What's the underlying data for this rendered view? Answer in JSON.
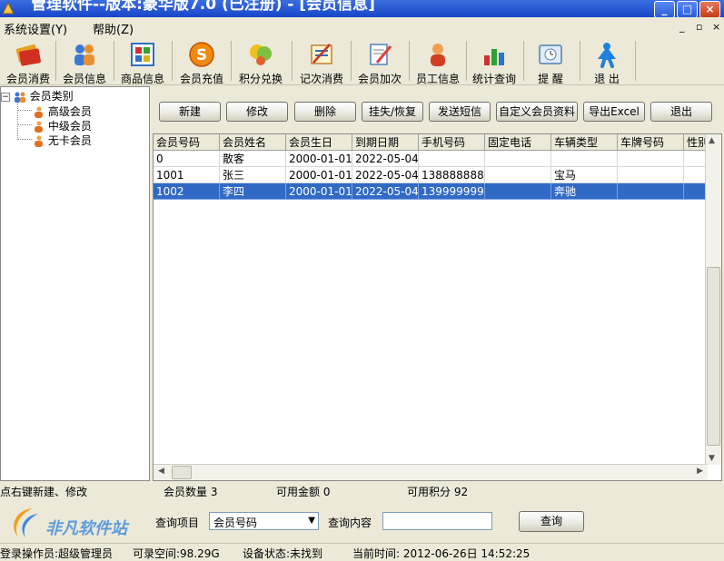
{
  "window": {
    "title": "管理软件--版本:豪华版7.0 (已注册) - [会员信息]",
    "controls": [
      "_",
      "□",
      "×"
    ]
  },
  "menubar": {
    "items": [
      "系统设置(Y)",
      "帮助(Z)"
    ],
    "mdi_controls": [
      "_",
      "▫",
      "×"
    ]
  },
  "toolbar": {
    "items": [
      {
        "label": "会员消费",
        "icon": "member-consume-icon"
      },
      {
        "label": "会员信息",
        "icon": "member-info-icon"
      },
      {
        "label": "商品信息",
        "icon": "product-info-icon"
      },
      {
        "label": "会员充值",
        "icon": "recharge-icon"
      },
      {
        "label": "积分兑换",
        "icon": "points-exchange-icon"
      },
      {
        "label": "记次消费",
        "icon": "count-consume-icon"
      },
      {
        "label": "会员加次",
        "icon": "add-count-icon"
      },
      {
        "label": "员工信息",
        "icon": "employee-icon"
      },
      {
        "label": "统计查询",
        "icon": "statistics-icon"
      },
      {
        "label": "提 醒",
        "icon": "reminder-icon"
      },
      {
        "label": "退 出",
        "icon": "exit-icon"
      }
    ]
  },
  "tree": {
    "root": "会员类别",
    "children": [
      "高级会员",
      "中级会员",
      "无卡会员"
    ]
  },
  "actions": [
    "新建",
    "修改",
    "删除",
    "挂失/恢复",
    "发送短信",
    "自定义会员资料",
    "导出Excel",
    "退出"
  ],
  "grid": {
    "columns": [
      "会员号码",
      "会员姓名",
      "会员生日",
      "到期日期",
      "手机号码",
      "固定电话",
      "车辆类型",
      "车牌号码",
      "性别"
    ],
    "rows": [
      [
        "0",
        "散客",
        "2000-01-01",
        "2022-05-04",
        "",
        "",
        "",
        "",
        ""
      ],
      [
        "1001",
        "张三",
        "2000-01-01",
        "2022-05-04",
        "138888888",
        "",
        "宝马",
        "",
        ""
      ],
      [
        "1002",
        "李四",
        "2000-01-01",
        "2022-05-04",
        "139999999",
        "",
        "奔驰",
        "",
        ""
      ]
    ],
    "selected_row": 2
  },
  "status": {
    "hint": "点右键新建、修改",
    "member_count": "会员数量 3",
    "available_amount": "可用金额 0",
    "available_points": "可用积分 92"
  },
  "query": {
    "logo_text": "非凡软件站",
    "item_label": "查询项目",
    "item_value": "会员号码",
    "content_label": "查询内容",
    "content_value": "",
    "button": "查询"
  },
  "bottom_status": {
    "operator": "登录操作员:超级管理员",
    "space": "可录空间:98.29G",
    "device": "设备状态:未找到",
    "time": "当前时间: 2012-06-26日 14:52:25"
  },
  "colors": {
    "selection": "#316ac5",
    "titlebar": "#1846c8",
    "background": "#ece9d8"
  }
}
